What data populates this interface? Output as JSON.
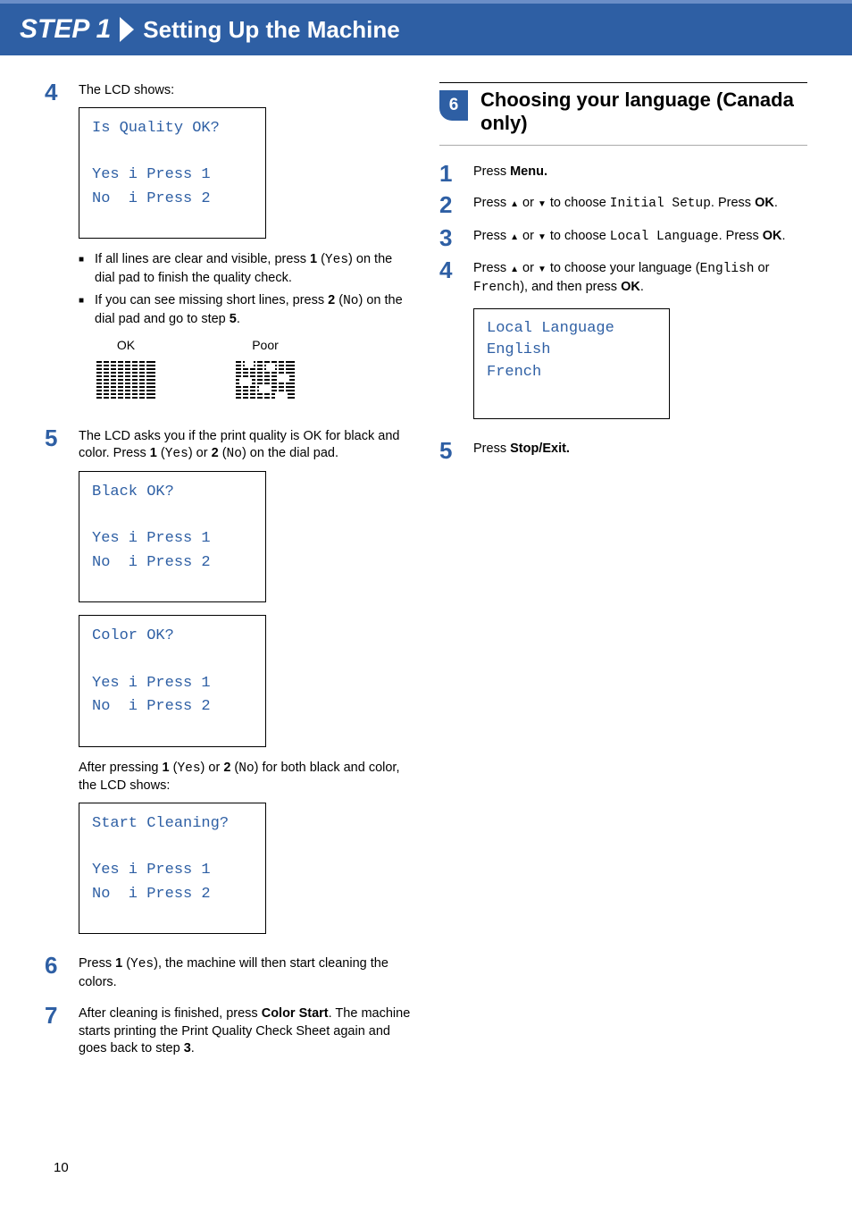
{
  "header": {
    "step_label": "STEP 1",
    "title": "Setting Up the Machine"
  },
  "left": {
    "s4": {
      "intro": "The LCD shows:",
      "lcd": "Is Quality OK?\n\nYes i Press 1\nNo  i Press 2",
      "bullet1_a": "If all lines are clear and visible, press ",
      "bullet1_key": "1",
      "bullet1_paren": "Yes",
      "bullet1_b": ") on the dial pad to finish the quality check.",
      "bullet2_a": "If you can see missing short lines, press ",
      "bullet2_key": "2",
      "bullet2_paren": "No",
      "bullet2_b": ") on the dial pad and go to step ",
      "bullet2_step": "5",
      "ok_label": "OK",
      "poor_label": "Poor"
    },
    "s5": {
      "text_a": "The LCD asks you if the print quality is OK for black and color. Press ",
      "key1": "1",
      "paren1": "Yes",
      "mid": ") or ",
      "key2": "2",
      "paren2": "No",
      "text_b": ") on the dial pad.",
      "lcd_black": "Black OK?\n\nYes i Press 1\nNo  i Press 2",
      "lcd_color": "Color OK?\n\nYes i Press 1\nNo  i Press 2",
      "after_a": "After pressing ",
      "after_mid": ") for both black and color, the LCD shows:",
      "lcd_start": "Start Cleaning?\n\nYes i Press 1\nNo  i Press 2"
    },
    "s6": {
      "text_a": "Press ",
      "key": "1",
      "paren": "Yes",
      "text_b": "), the machine will then start cleaning the colors."
    },
    "s7": {
      "text_a": "After cleaning is finished, press ",
      "key": "Color Start",
      "text_b": ". The machine starts printing the Print Quality Check Sheet again and goes back to step ",
      "step": "3"
    }
  },
  "right": {
    "section": {
      "num": "6",
      "title": "Choosing your language (Canada only)"
    },
    "s1": {
      "text_a": "Press ",
      "key": "Menu."
    },
    "s2": {
      "text_a": "Press ",
      "text_b": " or ",
      "text_c": " to choose ",
      "mono": "Initial Setup",
      "text_d": ". Press ",
      "key": "OK",
      "text_e": "."
    },
    "s3": {
      "text_a": "Press ",
      "text_b": " or ",
      "text_c": " to choose ",
      "mono": "Local Language",
      "text_d": ". Press ",
      "key": "OK",
      "text_e": "."
    },
    "s4": {
      "text_a": "Press ",
      "text_b": " or ",
      "text_c": " to choose your language (",
      "mono1": "English",
      "mid": " or ",
      "mono2": "French",
      "text_d": "), and then press ",
      "key": "OK",
      "text_e": ".",
      "lcd": "Local Language\nEnglish\nFrench"
    },
    "s5": {
      "text_a": "Press ",
      "key": "Stop/Exit."
    }
  },
  "page_number": "10",
  "nums": {
    "n1": "1",
    "n2": "2",
    "n3": "3",
    "n4": "4",
    "n5": "5",
    "n6": "6",
    "n7": "7"
  }
}
